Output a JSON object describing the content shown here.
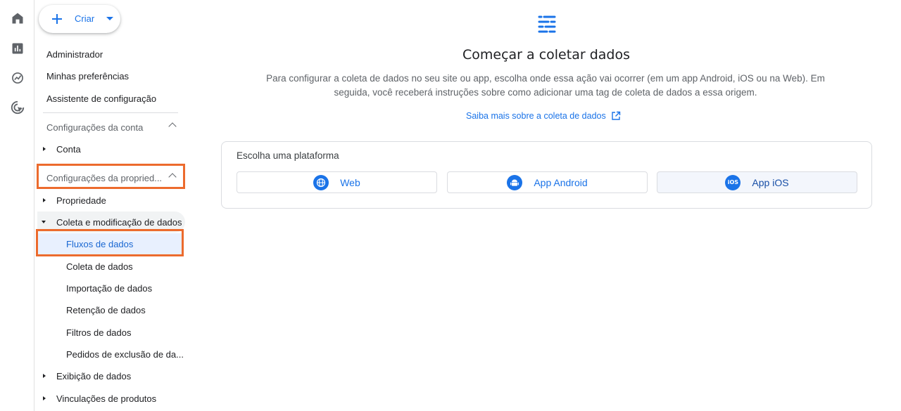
{
  "rail": {
    "icons": [
      "home-icon",
      "reports-icon",
      "explore-icon",
      "advertising-icon"
    ]
  },
  "sidebar": {
    "create_label": "Criar",
    "top_items": [
      "Administrador",
      "Minhas preferências",
      "Assistente de configuração"
    ],
    "account_section": "Configurações da conta",
    "account_item": "Conta",
    "property_section": "Configurações da propried...",
    "property_item": "Propriedade",
    "expanded_group": "Coleta e modificação de dados",
    "sub_items": [
      "Fluxos de dados",
      "Coleta de dados",
      "Importação de dados",
      "Retenção de dados",
      "Filtros de dados",
      "Pedidos de exclusão de da..."
    ],
    "bottom_items": [
      "Exibição de dados",
      "Vinculações de produtos"
    ]
  },
  "main": {
    "title": "Começar a coletar dados",
    "description": "Para configurar a coleta de dados no seu site ou app, escolha onde essa ação vai ocorrer (em um app Android, iOS ou na Web). Em seguida, você receberá instruções sobre como adicionar uma tag de coleta de dados a essa origem.",
    "learn_more": "Saiba mais sobre a coleta de dados",
    "platform_card": {
      "title": "Escolha uma plataforma",
      "options": [
        "Web",
        "App Android",
        "App iOS"
      ],
      "ios_badge": "iOS"
    }
  },
  "colors": {
    "accent": "#1a73e8",
    "highlight": "#ec6b2d",
    "selected_bg": "#e8f0fe"
  }
}
